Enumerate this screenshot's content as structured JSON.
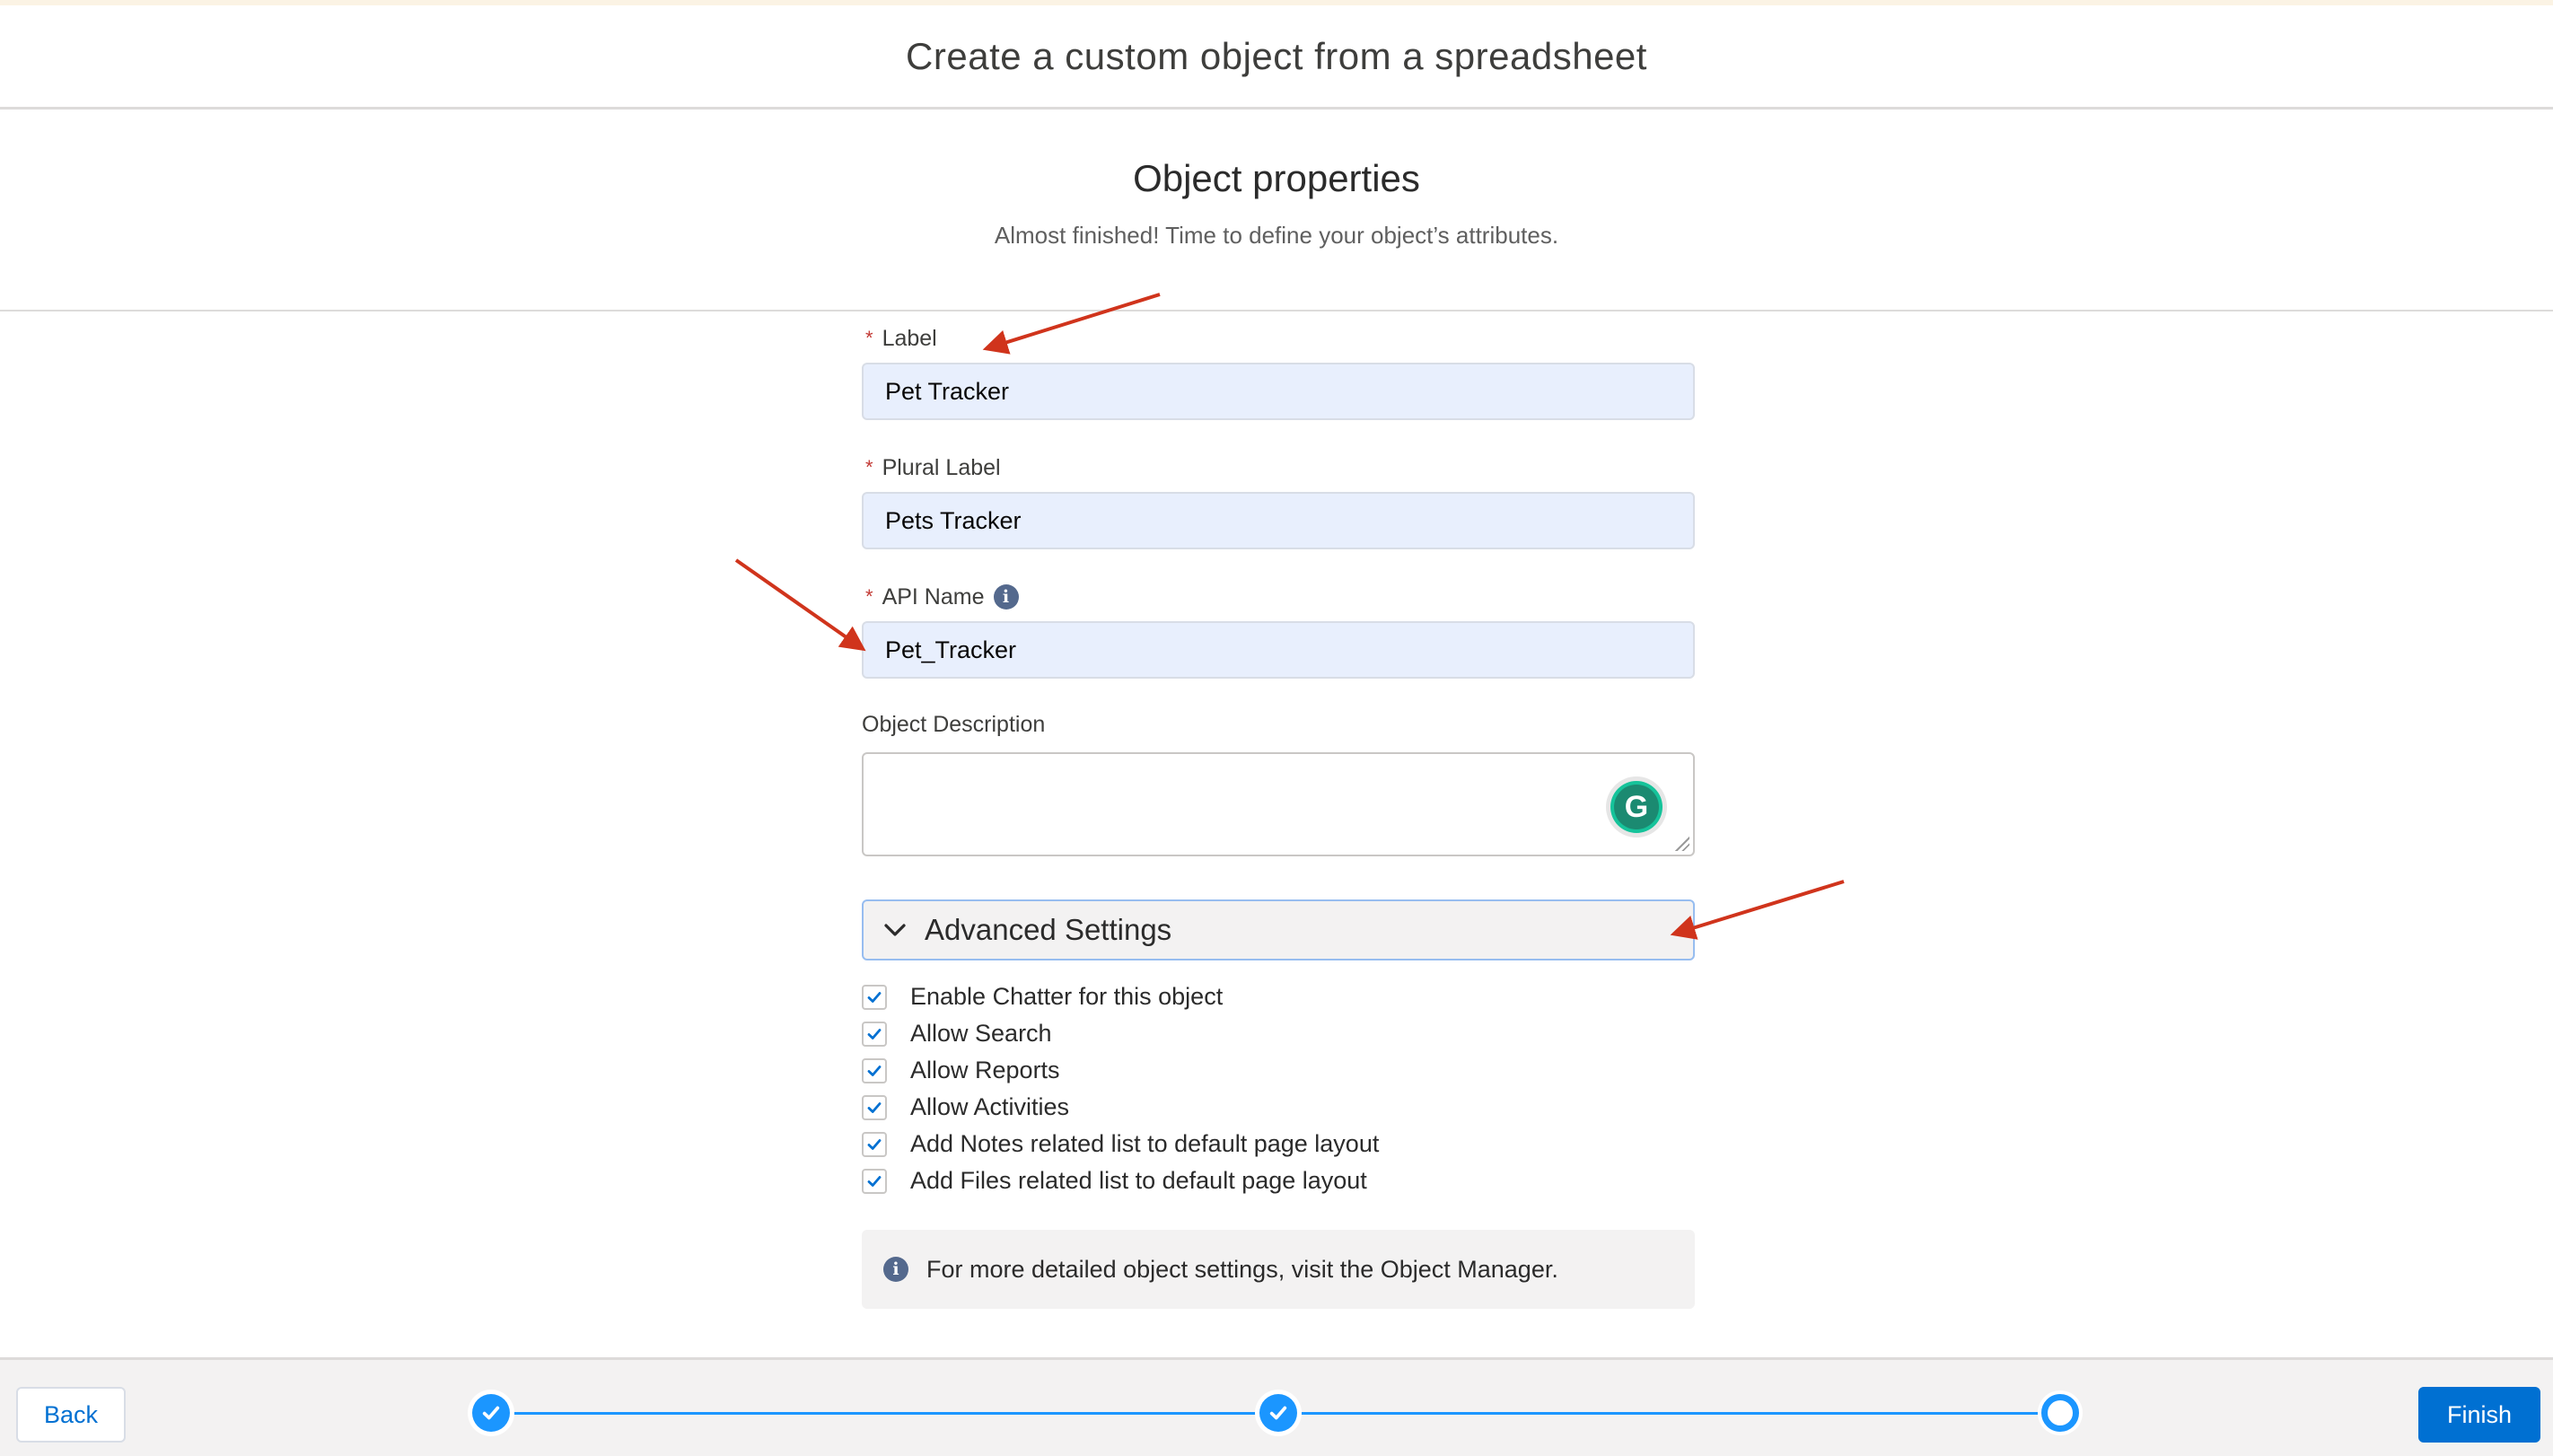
{
  "header": {
    "title": "Create a custom object from a spreadsheet"
  },
  "section": {
    "title": "Object properties",
    "subtitle": "Almost finished! Time to define your object’s attributes."
  },
  "form": {
    "label": {
      "label": "Label",
      "required_marker": "*",
      "value": "Pet Tracker"
    },
    "plural_label": {
      "label": "Plural Label",
      "required_marker": "*",
      "value": "Pets Tracker"
    },
    "api_name": {
      "label": "API Name",
      "required_marker": "*",
      "value": "Pet_Tracker",
      "icon": "info-icon"
    },
    "description": {
      "label": "Object Description",
      "value": "",
      "extension_icon": "grammarly-icon"
    }
  },
  "advanced": {
    "title": "Advanced Settings",
    "icon": "chevron-down-icon",
    "options": [
      {
        "label": "Enable Chatter for this object",
        "checked": true
      },
      {
        "label": "Allow Search",
        "checked": true
      },
      {
        "label": "Allow Reports",
        "checked": true
      },
      {
        "label": "Allow Activities",
        "checked": true
      },
      {
        "label": "Add Notes related list to default page layout",
        "checked": true
      },
      {
        "label": "Add Files related list to default page layout",
        "checked": true
      }
    ]
  },
  "info_box": {
    "icon": "info-icon",
    "text": "For more detailed object settings, visit the Object Manager."
  },
  "footer": {
    "back_label": "Back",
    "finish_label": "Finish",
    "steps": [
      {
        "state": "complete"
      },
      {
        "state": "complete"
      },
      {
        "state": "current"
      }
    ]
  },
  "colors": {
    "brand": "#0070d2",
    "progress": "#1b96ff",
    "required": "#c23934",
    "annotation_arrow": "#d0341c",
    "input_fill": "#e8effd"
  }
}
